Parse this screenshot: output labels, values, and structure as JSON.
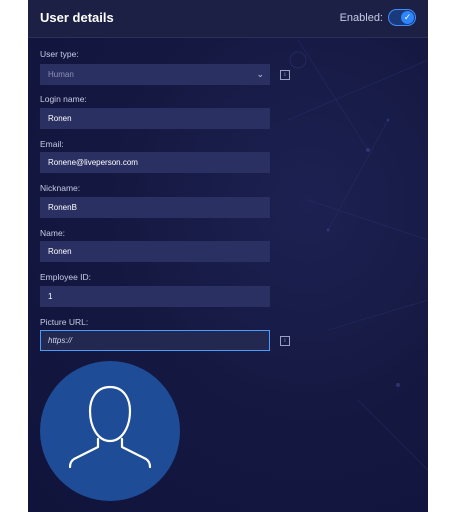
{
  "header": {
    "title": "User details",
    "enabled_label": "Enabled:",
    "enabled": true
  },
  "fields": {
    "user_type": {
      "label": "User type:",
      "value": "Human"
    },
    "login_name": {
      "label": "Login name:",
      "value": "Ronen"
    },
    "email": {
      "label": "Email:",
      "value": "Ronene@liveperson.com"
    },
    "nickname": {
      "label": "Nickname:",
      "value": "RonenB"
    },
    "name": {
      "label": "Name:",
      "value": "Ronen"
    },
    "employee_id": {
      "label": "Employee ID:",
      "value": "1"
    },
    "picture_url": {
      "label": "Picture URL:",
      "value": "",
      "placeholder": "https://"
    }
  },
  "icons": {
    "toggle_check": "check-icon",
    "select_arrow": "chevron-down-icon",
    "info": "info-icon",
    "avatar": "user-silhouette-icon"
  },
  "colors": {
    "panel_background": "#151942",
    "header_background": "#1c2045",
    "field_background": "#2b3063",
    "accent_blue": "#2e86ff",
    "avatar_background": "#1e4c97"
  }
}
